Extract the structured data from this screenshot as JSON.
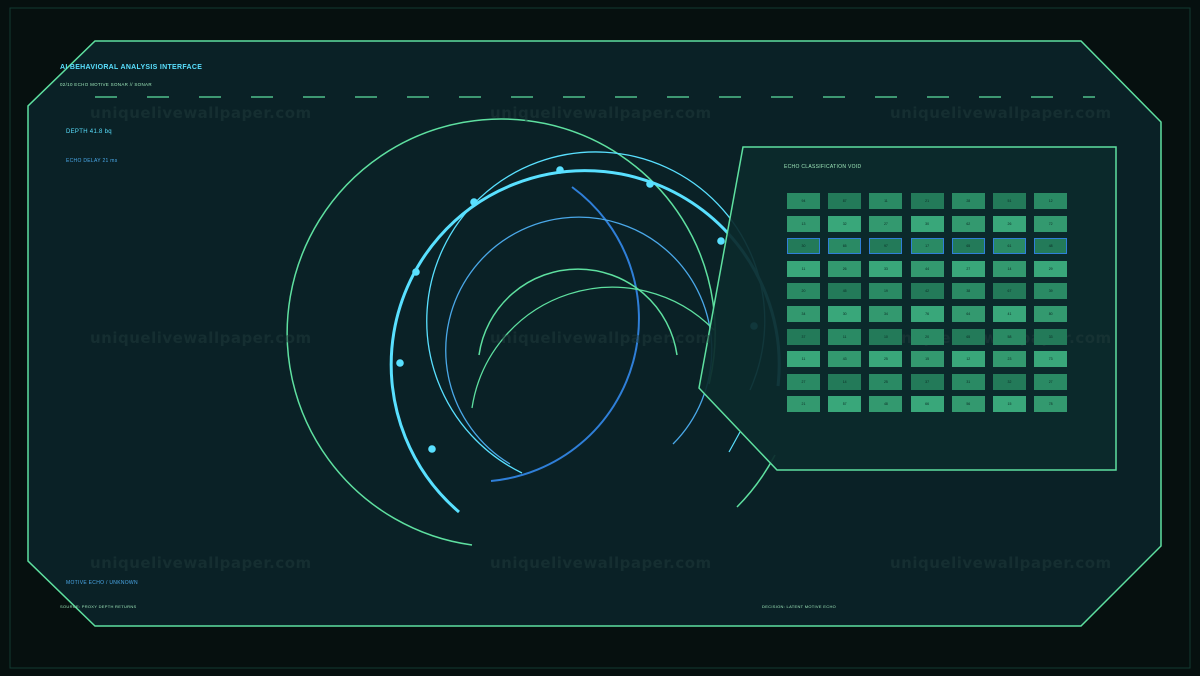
{
  "header": {
    "title": "AI BEHAVIORAL ANALYSIS INTERFACE",
    "subtitle": "02/10  ECHO MOTIVE SONAR  //  SONAR"
  },
  "readouts": {
    "depth": "DEPTH 41.8 bq",
    "echo_delay": "ECHO DELAY 21 ms"
  },
  "footer": {
    "motive": "MOTIVE ECHO / UNKNOWN",
    "source": "SOURCE: PROXY DEPTH RETURNS",
    "decision": "DECISION: LATENT MOTIVE ECHO"
  },
  "panel": {
    "title": "ECHO CLASSIFICATION VOID",
    "rows": [
      [
        "94",
        "87",
        "11",
        "21",
        "28",
        "51",
        "12"
      ],
      [
        "13",
        "32",
        "27",
        "30",
        "62",
        "26",
        "72"
      ],
      [
        "30",
        "65",
        "97",
        "17",
        "65",
        "61",
        "48"
      ],
      [
        "11",
        "26",
        "33",
        "44",
        "27",
        "14",
        "29"
      ],
      [
        "20",
        "45",
        "19",
        "42",
        "38",
        "67",
        "39"
      ],
      [
        "34",
        "30",
        "34",
        "76",
        "64",
        "41",
        "80"
      ],
      [
        "37",
        "11",
        "10",
        "20",
        "65",
        "58",
        "33"
      ],
      [
        "11",
        "43",
        "25",
        "15",
        "12",
        "23",
        "73"
      ],
      [
        "27",
        "14",
        "25",
        "37",
        "31",
        "32",
        "27"
      ],
      [
        "21",
        "57",
        "48",
        "66",
        "56",
        "15",
        "78"
      ]
    ],
    "highlight_row_index": 2,
    "cell_colors": [
      "#2a8a64",
      "#39a77a",
      "#237a59",
      "#33996f"
    ]
  },
  "watermark": "uniquelivewallpaper.com",
  "colors": {
    "frame": "#5ee0a0",
    "cyan": "#59e0ff",
    "blue": "#2f7fd8",
    "panel_bg": "#0c2a2c",
    "bg": "#0a2126"
  }
}
